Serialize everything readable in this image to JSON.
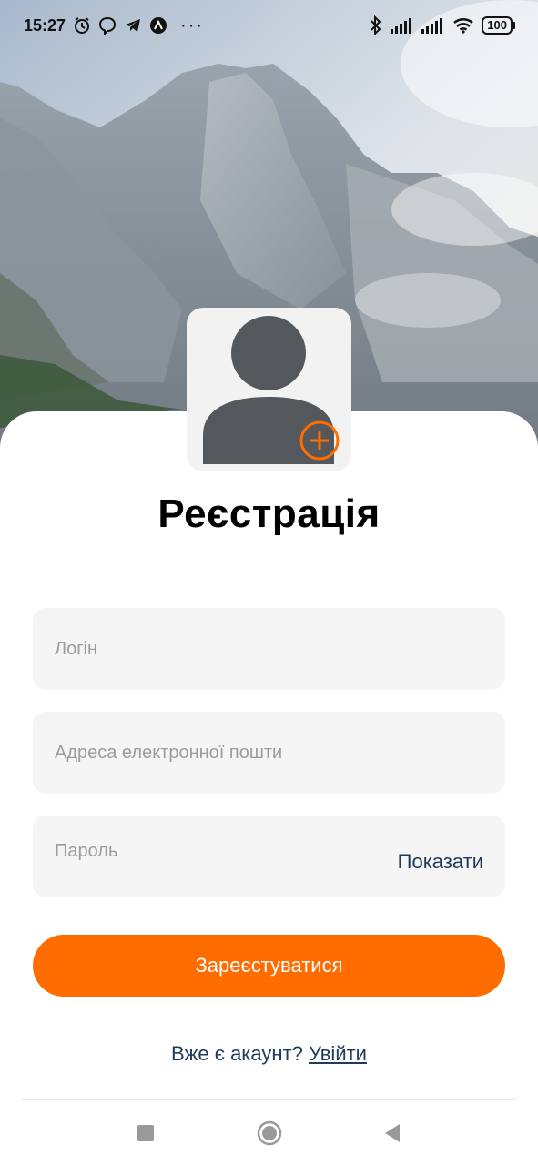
{
  "status_bar": {
    "time": "15:27",
    "battery": "100"
  },
  "avatar": {
    "add_icon": "plus-circle-icon",
    "accent": "#ff6c00"
  },
  "form": {
    "title": "Реєстрація",
    "login_placeholder": "Логін",
    "email_placeholder": "Адреса електронної пошти",
    "password_placeholder": "Пароль",
    "show_password_label": "Показати",
    "submit_label": "Зареєстуватися"
  },
  "footer": {
    "have_account_text": "Вже є акаунт?",
    "login_link": "Увійти"
  },
  "nav": {
    "icons": [
      "recents-square-icon",
      "home-circle-icon",
      "back-triangle-icon"
    ]
  },
  "colors": {
    "primary": "#ff6c00",
    "link": "#1f3b5a",
    "field_bg": "#f5f5f5"
  }
}
